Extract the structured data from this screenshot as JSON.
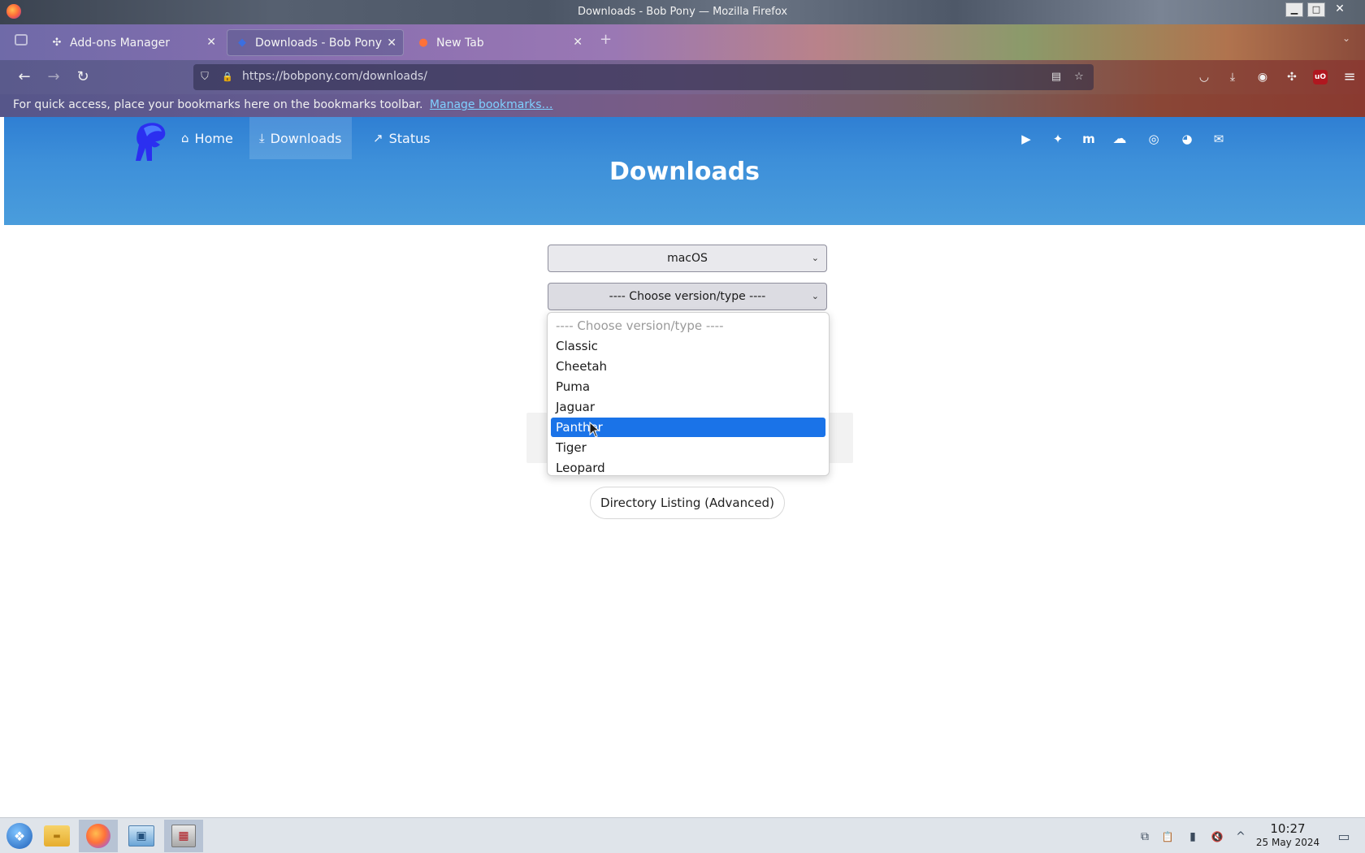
{
  "window": {
    "title": "Downloads - Bob Pony — Mozilla Firefox",
    "min_glyph": "▁",
    "max_glyph": "□",
    "close_glyph": "✕"
  },
  "tabs": [
    {
      "label": "Add-ons Manager",
      "icon": "puzzle-icon",
      "glyph": "✣",
      "close": "✕"
    },
    {
      "label": "Downloads - Bob Pony",
      "icon": "bobpony-favicon",
      "glyph": "◆",
      "close": "✕"
    },
    {
      "label": "New Tab",
      "icon": "firefox-icon",
      "glyph": "●",
      "close": "✕"
    }
  ],
  "newtab_glyph": "+",
  "tabs_overflow_glyph": "⌄",
  "nav": {
    "back_glyph": "←",
    "forward_glyph": "→",
    "reload_glyph": "↻",
    "url": "https://bobpony.com/downloads/",
    "shield_glyph": "⛉",
    "lock_glyph": "🔒",
    "reader_glyph": "▤",
    "star_glyph": "☆",
    "pocket_glyph": "◡",
    "download_glyph": "⤓",
    "account_glyph": "◉",
    "extensions_glyph": "✣",
    "ublock_glyph": "uO",
    "menu_glyph": "≡"
  },
  "bookmarks_bar": {
    "text": "For quick access, place your bookmarks here on the bookmarks toolbar.",
    "link": "Manage bookmarks…"
  },
  "site": {
    "nav": [
      {
        "label": "Home",
        "glyph": "⌂"
      },
      {
        "label": "Downloads",
        "glyph": "⤓"
      },
      {
        "label": "Status",
        "glyph": "↗"
      }
    ],
    "social": [
      {
        "name": "youtube-icon",
        "glyph": "▶"
      },
      {
        "name": "twitter-icon",
        "glyph": "✦"
      },
      {
        "name": "mastodon-icon",
        "glyph": "m"
      },
      {
        "name": "cloud-icon",
        "glyph": "☁"
      },
      {
        "name": "discord-icon",
        "glyph": "◎"
      },
      {
        "name": "github-icon",
        "glyph": "◕"
      },
      {
        "name": "email-icon",
        "glyph": "✉"
      }
    ],
    "page_title": "Downloads",
    "os_select": {
      "value": "macOS",
      "caret": "⌄"
    },
    "version_select": {
      "value": "---- Choose version/type ----",
      "caret": "⌄"
    },
    "dropdown": {
      "options": [
        "---- Choose version/type ----",
        "Classic",
        "Cheetah",
        "Puma",
        "Jaguar",
        "Panther",
        "Tiger",
        "Leopard"
      ],
      "highlighted": "Panther"
    },
    "directory_button": "Directory Listing (Advanced)"
  },
  "taskbar": {
    "items": [
      {
        "name": "start-menu-icon",
        "glyph": "❖"
      },
      {
        "name": "file-manager-icon",
        "glyph": "▬"
      },
      {
        "name": "firefox-taskbar-icon",
        "glyph": "●"
      },
      {
        "name": "system-settings-icon",
        "glyph": "▣"
      },
      {
        "name": "app-installer-icon",
        "glyph": "▦"
      }
    ],
    "tray": [
      {
        "name": "network-icon",
        "glyph": "⧉"
      },
      {
        "name": "clipboard-icon",
        "glyph": "📋"
      },
      {
        "name": "battery-icon",
        "glyph": "▮"
      },
      {
        "name": "volume-muted-icon",
        "glyph": "🔇"
      },
      {
        "name": "tray-expand-icon",
        "glyph": "^"
      }
    ],
    "time": "10:27",
    "date": "25 May 2024",
    "show_desktop_glyph": "▭"
  },
  "colors": {
    "hero_top": "#2f7fd3",
    "hero_bottom": "#4a9ddc",
    "highlight": "#1a73e8",
    "link": "#7fd0ff"
  }
}
